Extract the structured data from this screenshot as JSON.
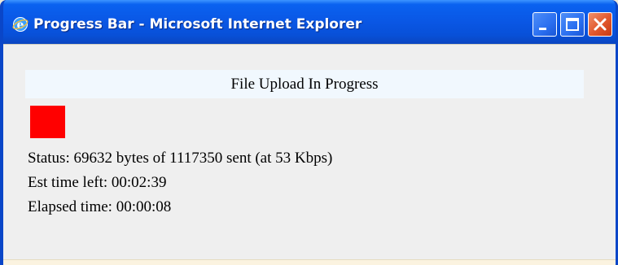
{
  "window": {
    "title": "Progress Bar - Microsoft Internet Explorer"
  },
  "icons": {
    "app": "internet-explorer-icon",
    "minimize": "minimize-icon",
    "maximize": "maximize-icon",
    "close": "close-icon"
  },
  "upload": {
    "heading": "File Upload In Progress",
    "status": "Status: 69632 bytes of 1117350 sent (at 53 Kbps)",
    "est_time_left": "Est time left: 00:02:39",
    "elapsed_time": "Elapsed time: 00:00:08"
  },
  "colors": {
    "progress_fill": "#ff0000",
    "heading_band": "#f1f8fe",
    "client_bg": "#efefef",
    "title_bar": "#0a58e6",
    "close_button": "#e1572c"
  }
}
